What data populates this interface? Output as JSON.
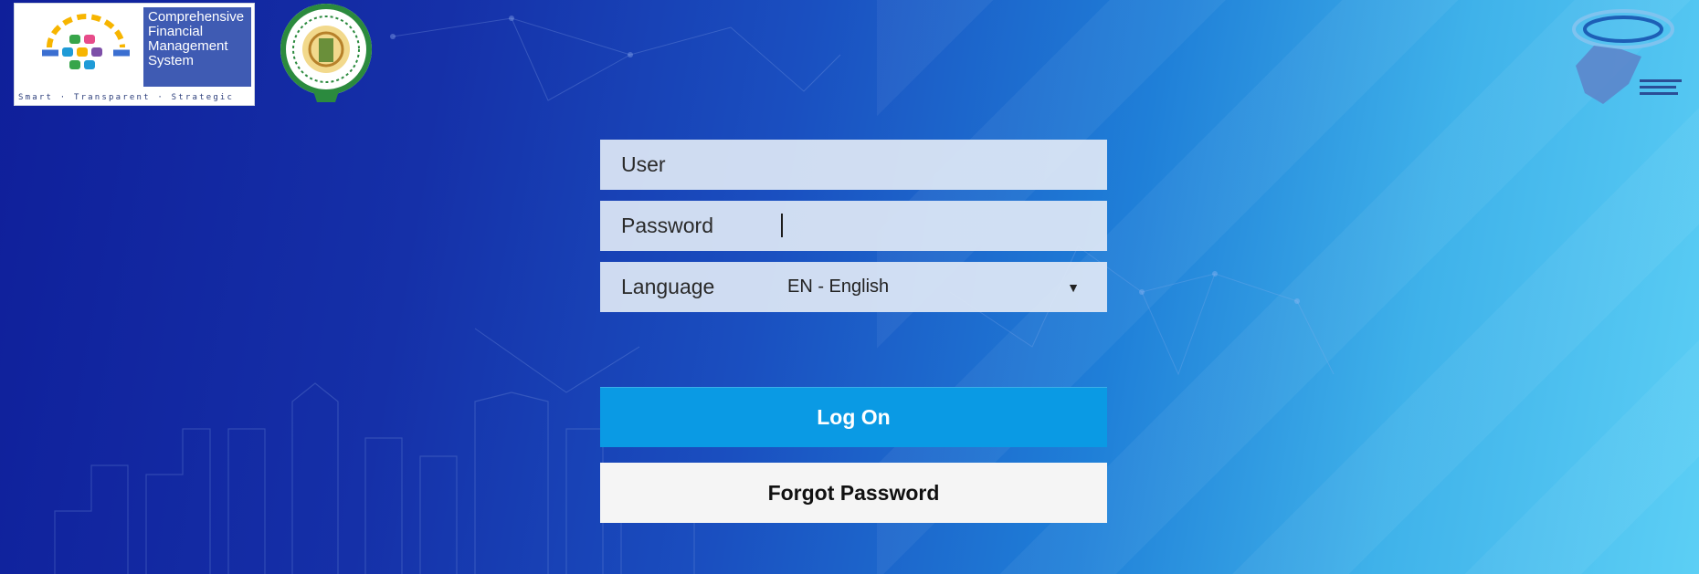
{
  "header": {
    "cfms_logo": {
      "title_lines": [
        "Comprehensive",
        "Financial",
        "Management",
        "System"
      ],
      "tagline": "Smart · Transparent · Strategic"
    },
    "seal_icon": "government-of-andhra-pradesh-seal",
    "apcfss_icon": "apcfss-logo"
  },
  "login": {
    "user_label": "User",
    "password_label": "Password",
    "language_label": "Language",
    "language_value": "EN - English",
    "dropdown_arrow": "▼",
    "logon_button": "Log On",
    "forgot_button": "Forgot Password"
  },
  "colors": {
    "primary_button": "#0a9ae4",
    "secondary_button": "#f5f5f5",
    "field_bg": "#dee7f5"
  }
}
